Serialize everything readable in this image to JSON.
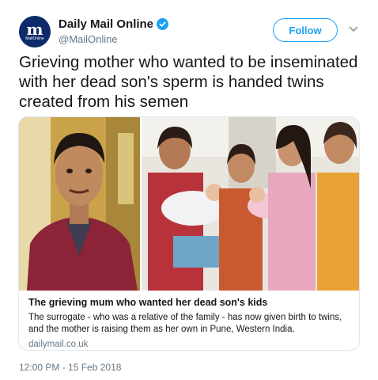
{
  "account": {
    "display_name": "Daily Mail Online",
    "handle": "@MailOnline",
    "avatar_glyph": "m",
    "avatar_subtext": "MailOnline",
    "verified_icon": "verified-badge-icon"
  },
  "actions": {
    "follow_label": "Follow",
    "menu_icon": "chevron-down-icon"
  },
  "tweet": {
    "text": "Grieving mother who wanted to be inseminated with her dead son's sperm is handed twins created from his semen",
    "timestamp": "12:00 PM - 15 Feb 2018"
  },
  "card": {
    "title": "The grieving mum who wanted her dead son's kids",
    "description": "The surrogate - who was a relative of the family - has now given birth to twins, and the mother is raising them as her own in Pune, Western India.",
    "domain": "dailymail.co.uk"
  },
  "colors": {
    "accent": "#1da1f2",
    "text": "#14171a",
    "secondary": "#657786",
    "border": "#e1e8ed",
    "avatar_bg": "#0d2a6b"
  }
}
